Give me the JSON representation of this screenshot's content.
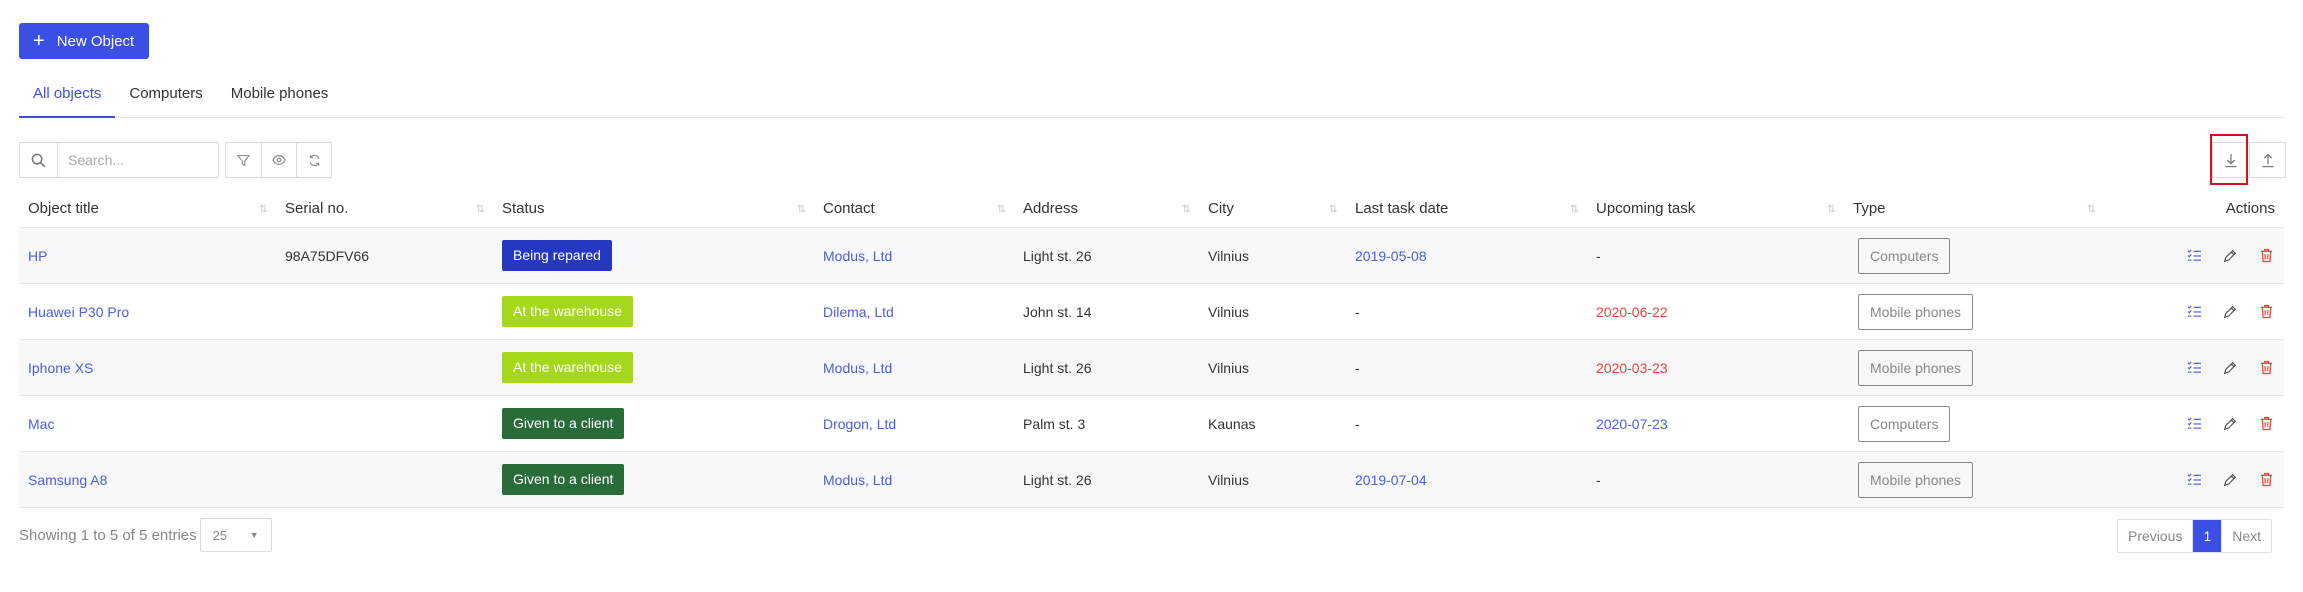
{
  "new_object_button": {
    "label": "New Object"
  },
  "tabs": [
    {
      "label": "All objects"
    },
    {
      "label": "Computers"
    },
    {
      "label": "Mobile phones"
    }
  ],
  "search": {
    "placeholder": "Search..."
  },
  "table": {
    "headers": [
      "Object title",
      "Serial no.",
      "Status",
      "Contact",
      "Address",
      "City",
      "Last task date",
      "Upcoming task",
      "Type",
      "Actions"
    ],
    "rows": [
      {
        "title": "HP",
        "serial": "98A75DFV66",
        "status": "Being repared",
        "status_color": "#2438c4",
        "contact": "Modus, Ltd",
        "address": "Light st. 26",
        "city": "Vilnius",
        "last_task": "2019-05-08",
        "upcoming": "-",
        "type": "Computers"
      },
      {
        "title": "Huawei P30 Pro",
        "serial": "",
        "status": "At the warehouse",
        "status_color": "#a6d81a",
        "contact": "Dilema, Ltd",
        "address": "John st. 14",
        "city": "Vilnius",
        "last_task": "-",
        "upcoming": "2020-06-22",
        "type": "Mobile phones"
      },
      {
        "title": "Iphone XS",
        "serial": "",
        "status": "At the warehouse",
        "status_color": "#a6d81a",
        "contact": "Modus, Ltd",
        "address": "Light st. 26",
        "city": "Vilnius",
        "last_task": "-",
        "upcoming": "2020-03-23",
        "type": "Mobile phones"
      },
      {
        "title": "Mac",
        "serial": "",
        "status": "Given to a client",
        "status_color": "#2a6b3a",
        "contact": "Drogon, Ltd",
        "address": "Palm st. 3",
        "city": "Kaunas",
        "last_task": "-",
        "upcoming": "2020-07-23",
        "type": "Computers"
      },
      {
        "title": "Samsung A8",
        "serial": "",
        "status": "Given to a client",
        "status_color": "#2a6b3a",
        "contact": "Modus, Ltd",
        "address": "Light st. 26",
        "city": "Vilnius",
        "last_task": "2019-07-04",
        "upcoming": "-",
        "type": "Mobile phones"
      }
    ]
  },
  "footer": {
    "info": "Showing 1 to 5 of 5 entries",
    "page_size": "25",
    "pagination": {
      "previous": "Previous",
      "current": "1",
      "next": "Next"
    }
  },
  "colors": {
    "accent": "#3b4fe4",
    "link": "#4a5ee0",
    "danger": "#e8443a",
    "highlight": "#d0151a"
  }
}
